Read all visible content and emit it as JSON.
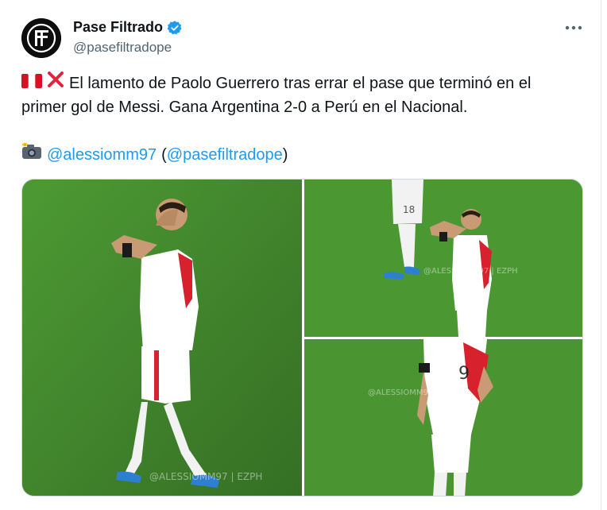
{
  "account": {
    "display_name": "Pase Filtrado",
    "handle": "@pasefiltradope",
    "avatar_letter": "PF",
    "verified_icon": "verified-badge-icon",
    "verified_color": "#1d9bf0"
  },
  "tweet": {
    "line1": "El lamento de Paolo Guerrero tras errar el pase que terminó en el",
    "line2": "primer gol de Messi. Gana Argentina 2-0 a Perú en el Nacional.",
    "credit_mention": "@alessiomm97",
    "credit_open": "(",
    "credit_mention2": "@pasefiltradope",
    "credit_close": ")"
  },
  "media": {
    "photo_left_watermark": "@ALESSIOMM97 | EZPH",
    "photo_top_right_watermark": "@ALESSIOMM97 | EZPH",
    "photo_bottom_right_watermark": "@ALESSIOMM97 | EZPH",
    "photo_top_right_player2_number": "18",
    "pitch_color": "#3f8a2c"
  },
  "icons": {
    "more": "more-horizontal-icon",
    "flag": "peru-flag-icon",
    "cross": "cross-mark-icon",
    "camera": "camera-flash-icon"
  }
}
